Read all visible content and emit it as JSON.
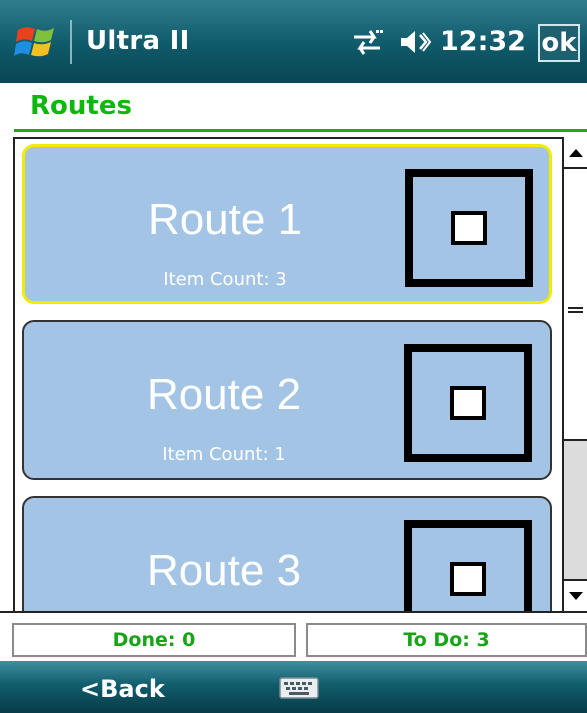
{
  "titlebar": {
    "app_title": "Ultra II",
    "clock": "12:32",
    "ok_label": "ok",
    "icons": [
      "windows-start-icon",
      "connectivity-icon",
      "volume-icon"
    ]
  },
  "header": {
    "title": "Routes"
  },
  "routes": [
    {
      "name": "Route 1",
      "count": "Item Count: 3",
      "selected": true
    },
    {
      "name": "Route 2",
      "count": "Item Count: 1",
      "selected": false
    },
    {
      "name": "Route 3",
      "count": "",
      "selected": false
    }
  ],
  "status": {
    "done": "Done: 0",
    "todo": "To Do: 3"
  },
  "bottombar": {
    "back_label": "<Back",
    "keyboard_icon": "keyboard-icon"
  },
  "colors": {
    "accent_green": "#0cb80c",
    "card_blue": "#a3c4e4",
    "selected_border": "#f2ea00",
    "titlebar_teal": "#0f5a6a"
  }
}
